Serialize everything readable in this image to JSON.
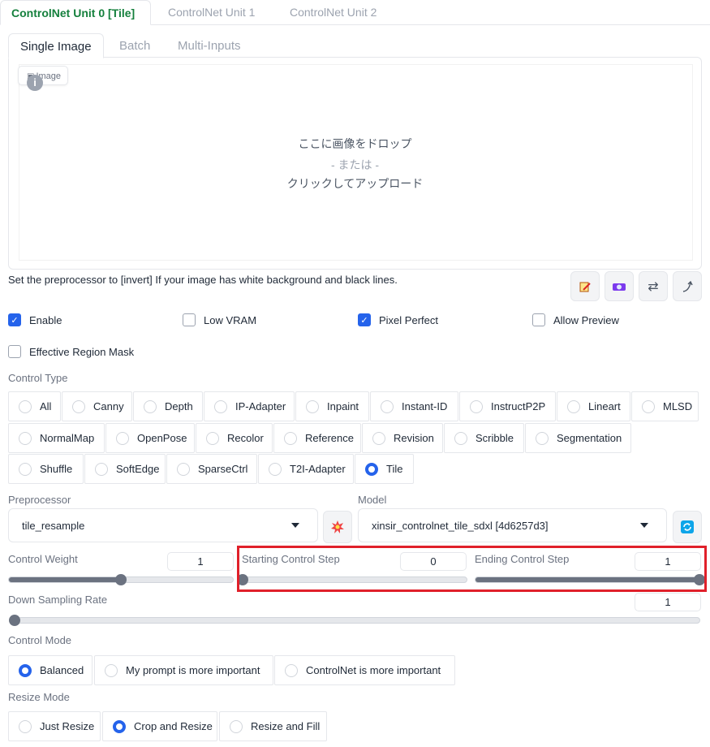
{
  "unit_tabs": [
    "ControlNet Unit 0 [Tile]",
    "ControlNet Unit 1",
    "ControlNet Unit 2"
  ],
  "image_tabs": [
    "Single Image",
    "Batch",
    "Multi-Inputs"
  ],
  "image_label": "Image",
  "drop": {
    "line1": "ここに画像をドロップ",
    "line2": "- または -",
    "line3": "クリックしてアップロード"
  },
  "hint": "Set the preprocessor to [invert] If your image has white background and black lines.",
  "checkboxes": {
    "enable": "Enable",
    "low_vram": "Low VRAM",
    "pixel_perfect": "Pixel Perfect",
    "allow_preview": "Allow Preview",
    "effective_region_mask": "Effective Region Mask"
  },
  "control_type": {
    "label": "Control Type",
    "options": [
      "All",
      "Canny",
      "Depth",
      "IP-Adapter",
      "Inpaint",
      "Instant-ID",
      "InstructP2P",
      "Lineart",
      "MLSD",
      "NormalMap",
      "OpenPose",
      "Recolor",
      "Reference",
      "Revision",
      "Scribble",
      "Segmentation",
      "Shuffle",
      "SoftEdge",
      "SparseCtrl",
      "T2I-Adapter",
      "Tile"
    ],
    "selected": "Tile"
  },
  "preprocessor": {
    "label": "Preprocessor",
    "value": "tile_resample"
  },
  "model": {
    "label": "Model",
    "value": "xinsir_controlnet_tile_sdxl [4d6257d3]"
  },
  "sliders": {
    "control_weight": {
      "label": "Control Weight",
      "value": "1",
      "fraction": 0.5
    },
    "starting_step": {
      "label": "Starting Control Step",
      "value": "0",
      "fraction": 0.0
    },
    "ending_step": {
      "label": "Ending Control Step",
      "value": "1",
      "fraction": 1.0
    },
    "down_sampling": {
      "label": "Down Sampling Rate",
      "value": "1",
      "fraction": 0.0
    }
  },
  "control_mode": {
    "label": "Control Mode",
    "options": [
      "Balanced",
      "My prompt is more important",
      "ControlNet is more important"
    ],
    "selected": "Balanced"
  },
  "resize_mode": {
    "label": "Resize Mode",
    "options": [
      "Just Resize",
      "Crop and Resize",
      "Resize and Fill"
    ],
    "selected": "Crop and Resize"
  },
  "colors": {
    "accent": "#2563eb",
    "active_tab": "#15803d",
    "highlight": "#e0202a"
  }
}
